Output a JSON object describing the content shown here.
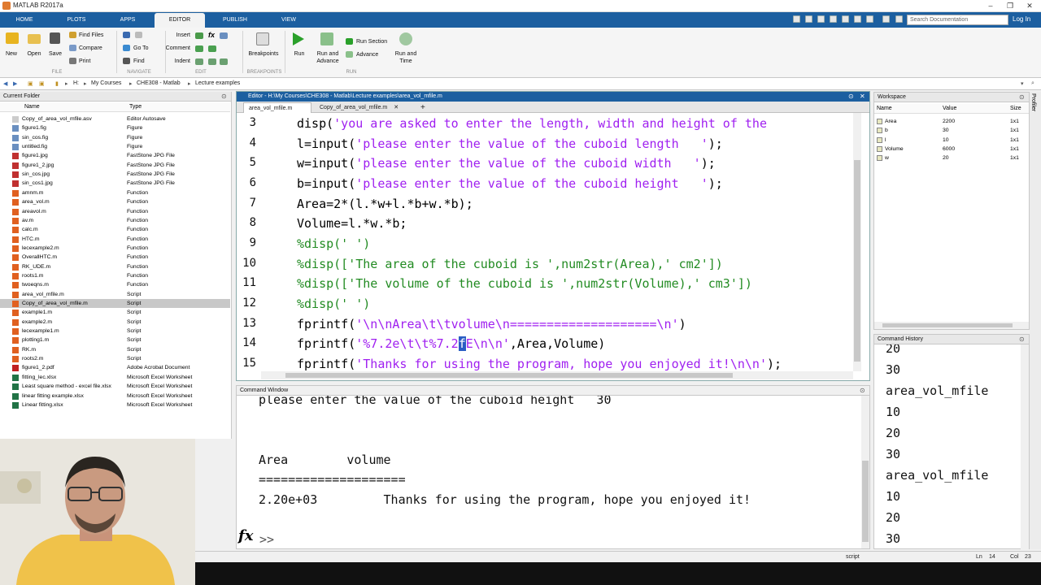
{
  "app": {
    "title": "MATLAB R2017a"
  },
  "tabs": [
    "HOME",
    "PLOTS",
    "APPS",
    "EDITOR",
    "PUBLISH",
    "VIEW"
  ],
  "search": {
    "placeholder": "Search Documentation"
  },
  "login": "Log In",
  "ribbon": {
    "new": "New",
    "open": "Open",
    "save": "Save",
    "find_files": "Find Files",
    "compare": "Compare",
    "print": "Print",
    "go_to": "Go To",
    "find": "Find",
    "insert": "Insert",
    "comment": "Comment",
    "indent": "Indent",
    "breakpoints": "Breakpoints",
    "run": "Run",
    "run_and_advance_1": "Run and",
    "run_and_advance_2": "Advance",
    "run_section": "Run Section",
    "advance": "Advance",
    "run_and_time_1": "Run and",
    "run_and_time_2": "Time",
    "groups": {
      "file": "FILE",
      "navigate": "NAVIGATE",
      "edit": "EDIT",
      "breakpoints": "BREAKPOINTS",
      "run": "RUN"
    }
  },
  "breadcrumb": [
    "H:",
    "My Courses",
    "CHE308 - Matlab",
    "Lecture examples"
  ],
  "current_folder": {
    "title": "Current Folder",
    "col_name": "Name",
    "col_type": "Type",
    "files": [
      {
        "name": "Copy_of_area_vol_mfile.asv",
        "type": "Editor Autosave",
        "icon": "#ccc"
      },
      {
        "name": "figure1.fig",
        "type": "Figure",
        "icon": "#6a8fc0"
      },
      {
        "name": "sin_cos.fig",
        "type": "Figure",
        "icon": "#6a8fc0"
      },
      {
        "name": "untitled.fig",
        "type": "Figure",
        "icon": "#6a8fc0"
      },
      {
        "name": "figure1.jpg",
        "type": "FastStone JPG File",
        "icon": "#c03030"
      },
      {
        "name": "figure1_2.jpg",
        "type": "FastStone JPG File",
        "icon": "#c03030"
      },
      {
        "name": "sin_cos.jpg",
        "type": "FastStone JPG File",
        "icon": "#c03030"
      },
      {
        "name": "sin_cos1.jpg",
        "type": "FastStone JPG File",
        "icon": "#c03030"
      },
      {
        "name": "amnm.m",
        "type": "Function",
        "icon": "#e06020"
      },
      {
        "name": "area_vol.m",
        "type": "Function",
        "icon": "#e06020"
      },
      {
        "name": "areavol.m",
        "type": "Function",
        "icon": "#e06020"
      },
      {
        "name": "av.m",
        "type": "Function",
        "icon": "#e06020"
      },
      {
        "name": "calc.m",
        "type": "Function",
        "icon": "#e06020"
      },
      {
        "name": "HTC.m",
        "type": "Function",
        "icon": "#e06020"
      },
      {
        "name": "lecexample2.m",
        "type": "Function",
        "icon": "#e06020"
      },
      {
        "name": "OverallHTC.m",
        "type": "Function",
        "icon": "#e06020"
      },
      {
        "name": "RK_UDE.m",
        "type": "Function",
        "icon": "#e06020"
      },
      {
        "name": "roots1.m",
        "type": "Function",
        "icon": "#e06020"
      },
      {
        "name": "twoeqns.m",
        "type": "Function",
        "icon": "#e06020"
      },
      {
        "name": "area_vol_mfile.m",
        "type": "Script",
        "icon": "#e06020"
      },
      {
        "name": "Copy_of_area_vol_mfile.m",
        "type": "Script",
        "icon": "#e06020",
        "selected": true
      },
      {
        "name": "example1.m",
        "type": "Script",
        "icon": "#e06020"
      },
      {
        "name": "example2.m",
        "type": "Script",
        "icon": "#e06020"
      },
      {
        "name": "lecexample1.m",
        "type": "Script",
        "icon": "#e06020"
      },
      {
        "name": "plotting1.m",
        "type": "Script",
        "icon": "#e06020"
      },
      {
        "name": "RK.m",
        "type": "Script",
        "icon": "#e06020"
      },
      {
        "name": "roots2.m",
        "type": "Script",
        "icon": "#e06020"
      },
      {
        "name": "figure1_2.pdf",
        "type": "Adobe Acrobat Document",
        "icon": "#c02020"
      },
      {
        "name": "fitting_lec.xlsx",
        "type": "Microsoft Excel Worksheet",
        "icon": "#217346"
      },
      {
        "name": "Least square method - excel file.xlsx",
        "type": "Microsoft Excel Worksheet",
        "icon": "#217346"
      },
      {
        "name": "linear fitting example.xlsx",
        "type": "Microsoft Excel Worksheet",
        "icon": "#217346"
      },
      {
        "name": "Linear fitting.xlsx",
        "type": "Microsoft Excel Worksheet",
        "icon": "#217346"
      }
    ]
  },
  "editor": {
    "title": "Editor - H:\\My Courses\\CHE308 - Matlab\\Lecture examples\\area_vol_mfile.m",
    "tabs": [
      "area_vol_mfile.m",
      "Copy_of_area_vol_mfile.m"
    ],
    "line_numbers": [
      "3",
      "4",
      "5",
      "6",
      "7",
      "8",
      "9",
      "10",
      "11",
      "12",
      "13",
      "14",
      "15"
    ]
  },
  "command_window": {
    "title": "Command Window",
    "lines": [
      "please enter the value of the cuboid height   30",
      "",
      "",
      "Area        volume",
      "====================",
      "2.20e+03         Thanks for using the program, hope you enjoyed it!"
    ],
    "prompt": ">>"
  },
  "workspace": {
    "title": "Workspace",
    "cols": [
      "Name",
      "Value",
      "Size"
    ],
    "vars": [
      {
        "name": "Area",
        "value": "2200",
        "size": "1x1"
      },
      {
        "name": "b",
        "value": "30",
        "size": "1x1"
      },
      {
        "name": "l",
        "value": "10",
        "size": "1x1"
      },
      {
        "name": "Volume",
        "value": "6000",
        "size": "1x1"
      },
      {
        "name": "w",
        "value": "20",
        "size": "1x1"
      }
    ]
  },
  "command_history": {
    "title": "Command History",
    "lines": [
      "20",
      "30",
      "area_vol_mfile",
      "10",
      "20",
      "30",
      "area_vol_mfile",
      "10",
      "20",
      "30"
    ]
  },
  "status": {
    "mode": "script",
    "ln_label": "Ln",
    "ln": "14",
    "col_label": "Col",
    "col": "23"
  },
  "profiler": "Profiler",
  "colors": {
    "accent": "#1c5fa0",
    "string": "#a020f0",
    "comment": "#228b22"
  }
}
